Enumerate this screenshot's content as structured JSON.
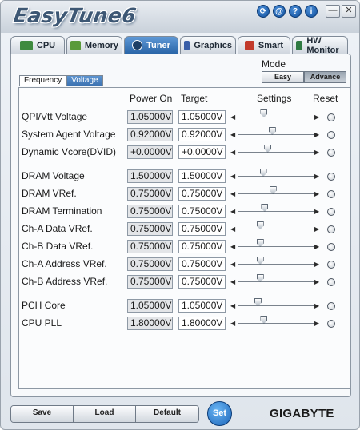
{
  "app": {
    "title": "EasyTune6",
    "brand": "GIGABYTE"
  },
  "title_icons": [
    {
      "icon": "update-icon",
      "glyph": "⟳"
    },
    {
      "icon": "web-icon",
      "glyph": "@"
    },
    {
      "icon": "help-icon",
      "glyph": "?"
    },
    {
      "icon": "info-icon",
      "glyph": "i"
    }
  ],
  "window_buttons": {
    "minimize": "—",
    "close": "✕"
  },
  "tabs": [
    {
      "label": "CPU",
      "icon": "cpu-chip-icon",
      "color": "#3f8a3f",
      "active": false
    },
    {
      "label": "Memory",
      "icon": "memory-stick-icon",
      "color": "#5a9a3a",
      "active": false
    },
    {
      "label": "Tuner",
      "icon": "tuner-dial-icon",
      "color": "#1d3f66",
      "active": true
    },
    {
      "label": "Graphics",
      "icon": "graphics-card-icon",
      "color": "#3a5fa8",
      "active": false
    },
    {
      "label": "Smart",
      "icon": "smart-cube-icon",
      "color": "#c23a2b",
      "active": false
    },
    {
      "label": "HW Monitor",
      "icon": "monitor-icon",
      "color": "#2f7a42",
      "active": false
    }
  ],
  "mode": {
    "label": "Mode",
    "options": [
      {
        "label": "Easy",
        "active": false
      },
      {
        "label": "Advance",
        "active": true
      }
    ]
  },
  "subtabs": [
    {
      "label": "Frequency",
      "active": false
    },
    {
      "label": "Voltage",
      "active": true
    }
  ],
  "columns": {
    "power_on": "Power On",
    "target": "Target",
    "settings": "Settings",
    "reset": "Reset"
  },
  "rows": [
    {
      "label": "QPI/Vtt Voltage",
      "power_on": "1.05000V",
      "target": "1.05000V",
      "slider_level": 0.34
    },
    {
      "label": "System Agent Voltage",
      "power_on": "0.92000V",
      "target": "0.92000V",
      "slider_level": 0.45
    },
    {
      "label": "Dynamic Vcore(DVID)",
      "power_on": "+0.0000V",
      "target": "+0.0000V",
      "slider_level": 0.39
    },
    {
      "label": "DRAM Voltage",
      "power_on": "1.50000V",
      "target": "1.50000V",
      "slider_level": 0.33
    },
    {
      "label": "DRAM VRef.",
      "power_on": "0.75000V",
      "target": "0.75000V",
      "slider_level": 0.46
    },
    {
      "label": "DRAM Termination",
      "power_on": "0.75000V",
      "target": "0.75000V",
      "slider_level": 0.35
    },
    {
      "label": "Ch-A Data VRef.",
      "power_on": "0.75000V",
      "target": "0.75000V",
      "slider_level": 0.29
    },
    {
      "label": "Ch-B Data VRef.",
      "power_on": "0.75000V",
      "target": "0.75000V",
      "slider_level": 0.29
    },
    {
      "label": "Ch-A Address VRef.",
      "power_on": "0.75000V",
      "target": "0.75000V",
      "slider_level": 0.29
    },
    {
      "label": "Ch-B Address VRef.",
      "power_on": "0.75000V",
      "target": "0.75000V",
      "slider_level": 0.29
    },
    {
      "label": "PCH Core",
      "power_on": "1.05000V",
      "target": "1.05000V",
      "slider_level": 0.26
    },
    {
      "label": "CPU PLL",
      "power_on": "1.80000V",
      "target": "1.80000V",
      "slider_level": 0.34
    }
  ],
  "bottom": {
    "save": "Save",
    "load": "Load",
    "default": "Default",
    "set": "Set"
  }
}
